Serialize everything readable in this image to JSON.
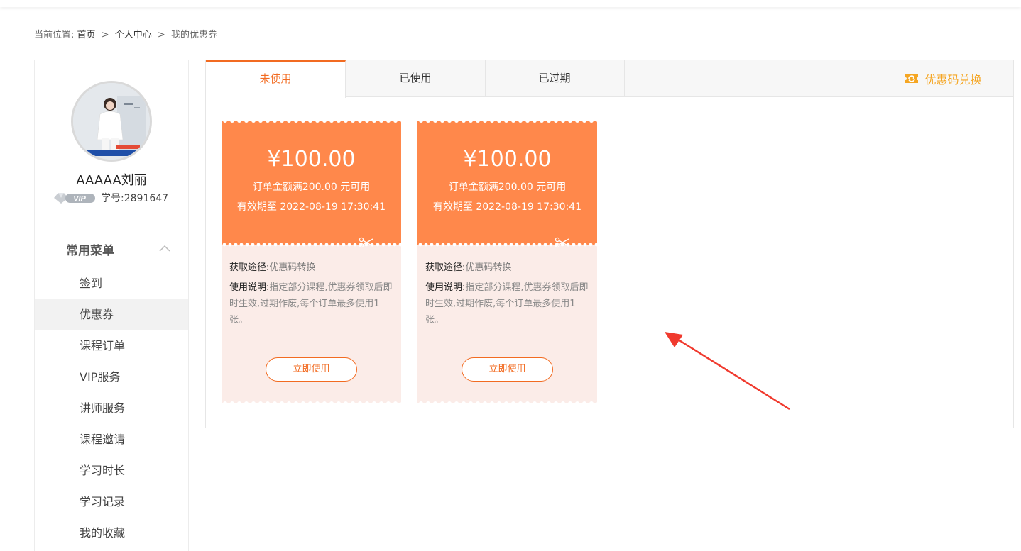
{
  "breadcrumb": {
    "label": "当前位置:",
    "home": "首页",
    "center": "个人中心",
    "current": "我的优惠券",
    "sep": ">"
  },
  "profile": {
    "name": "AAAAA刘丽",
    "vip_badge": "VIP",
    "student_id": "学号:2891647"
  },
  "menu": {
    "title": "常用菜单",
    "items": [
      {
        "label": "签到"
      },
      {
        "label": "优惠券"
      },
      {
        "label": "课程订单"
      },
      {
        "label": "VIP服务"
      },
      {
        "label": "讲师服务"
      },
      {
        "label": "课程邀请"
      },
      {
        "label": "学习时长"
      },
      {
        "label": "学习记录"
      },
      {
        "label": "我的收藏"
      }
    ],
    "active_index": 1
  },
  "tabs": [
    {
      "label": "未使用",
      "active": true
    },
    {
      "label": "已使用",
      "active": false
    },
    {
      "label": "已过期",
      "active": false
    }
  ],
  "exchange": {
    "label": "优惠码兑换",
    "icon": "ticket-icon"
  },
  "coupons": [
    {
      "price": "¥100.00",
      "condition": "订单金额满200.00 元可用",
      "expire": "有效期至 2022-08-19 17:30:41",
      "source_label": "获取途径:",
      "source": "优惠码转换",
      "desc_label": "使用说明:",
      "desc": "指定部分课程,优惠券领取后即时生效,过期作废,每个订单最多使用1张。",
      "button": "立即使用"
    },
    {
      "price": "¥100.00",
      "condition": "订单金额满200.00 元可用",
      "expire": "有效期至 2022-08-19 17:30:41",
      "source_label": "获取途径:",
      "source": "优惠码转换",
      "desc_label": "使用说明:",
      "desc": "指定部分课程,优惠券领取后即时生效,过期作废,每个订单最多使用1张。",
      "button": "立即使用"
    }
  ],
  "colors": {
    "accent": "#f26b21",
    "coupon_top": "#ff884b",
    "coupon_bottom": "#fbece8",
    "exchange": "#f5a623",
    "annotation_arrow": "#f03a2e"
  }
}
